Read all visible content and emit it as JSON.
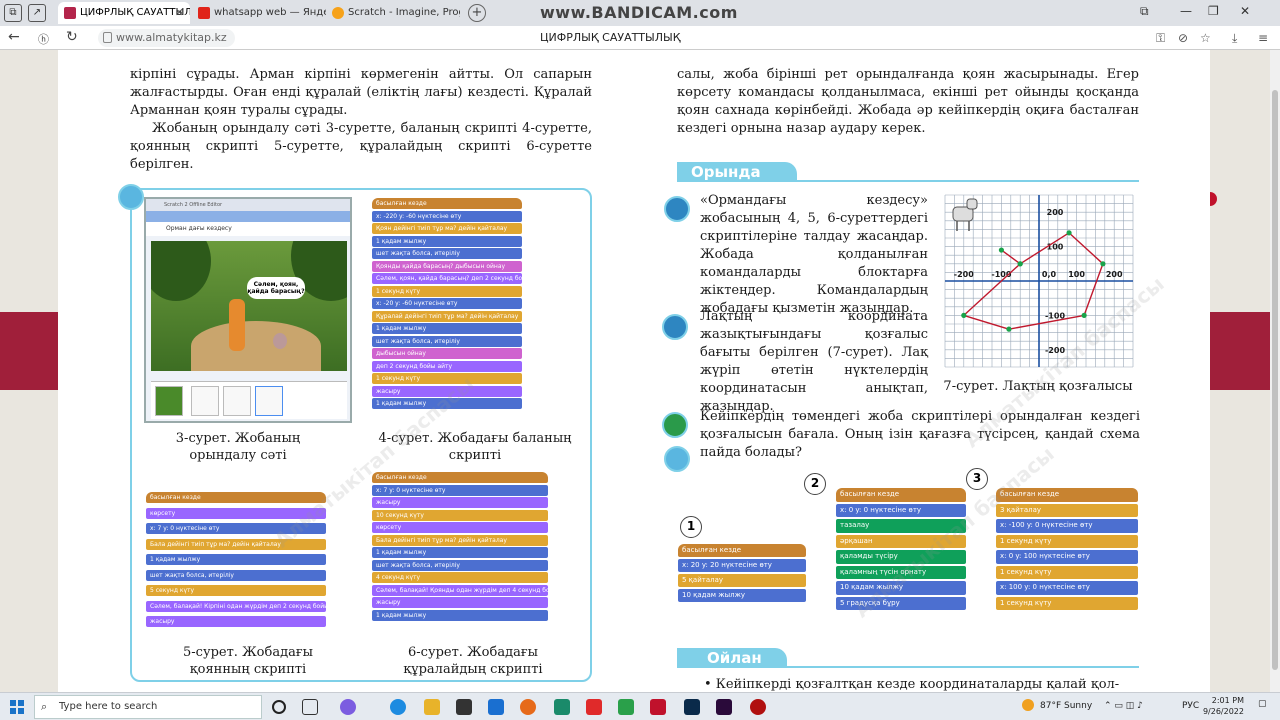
{
  "browser": {
    "tabs": [
      {
        "label": "ЦИФРЛЫҚ САУАТТЫЛЫ",
        "active": true
      },
      {
        "label": "whatsapp web — Яндекс:",
        "active": false
      },
      {
        "label": "Scratch - Imagine, Program",
        "active": false
      }
    ],
    "recorder_watermark": "www.BANDICAM.com",
    "url": "www.almatykitap.kz",
    "page_title": "ЦИФРЛЫҚ САУАТТЫЛЫҚ"
  },
  "left_page": {
    "intro": {
      "p1": "кірпіні сұрады. Арман кірпіні көрмегенін айтты. Ол сапарын жалғастырды. Оған енді құралай (еліктің лағы) кездесті. Құралай Арманнан қоян туралы сұрады.",
      "p2": "Жобаның орындалу сәті 3-суретте, баланың скрипті 4-суретте, қоянның скрипті 5-суретте, құралайдың скрипті 6-суретте берілген."
    },
    "screenshot": {
      "app_title": "Scratch 2 Offline Editor",
      "project_title": "Орман дағы кездесу",
      "speech": "Сәлем, қоян, қайда барасың?"
    },
    "captions": {
      "fig3": "3-сурет. Жобаның орындалу сәті",
      "fig4": "4-сурет. Жобадағы баланың скрипті",
      "fig5": "5-сурет. Жобадағы қоянның скрипті",
      "fig6": "6-сурет. Жобадағы құралайдың скрипті"
    },
    "fig4_blocks": [
      "басылған кезде",
      "x: -220 y: -60 нүктесіне өту",
      "Қоян дейінгі тиіп тұр ма? дейін қайталау",
      "1 қадам жылжу",
      "шет жақта болса, итеріліу",
      "Қоянды қайда барасың? дыбысын ойнау",
      "Сәлем, қоян, қайда барасың? деп 2 секунд бойы айту",
      "1 секунд күту",
      "x: -20 y: -60 нүктесіне өту",
      "Құралай дейінгі тиіп тұр ма? дейін қайталау",
      "1 қадам жылжу",
      "шет жақта болса, итеріліу",
      "дыбысын ойнау",
      "деп 2 секунд бойы айту",
      "1 секунд күту",
      "жасыру",
      "1 қадам жылжу"
    ],
    "fig5_blocks": [
      "басылған кезде",
      "көрсету",
      "x: 7 y: 0 нүктесіне өту",
      "Бала дейінгі тиіп тұр ма? дейін қайталау",
      "1 қадам жылжу",
      "шет жақта болса, итеріліу",
      "5 секунд күту",
      "Сәлем, балақай! Кірпіні одан жүрдім деп 2 секунд бойы айту",
      "жасыру"
    ],
    "fig6_blocks": [
      "басылған кезде",
      "x: 7 y: 0 нүктесіне өту",
      "жасыру",
      "10 секунд күту",
      "көрсету",
      "Бала дейінгі тиіп тұр ма? дейін қайталау",
      "1 қадам жылжу",
      "шет жақта болса, итеріліу",
      "4 секунд күту",
      "Сәлем, балақай! Қоянды одан жүрдім деп 4 секунд бойы айту",
      "жасыру",
      "1 қадам жылжу"
    ]
  },
  "right_page": {
    "intro": "салы, жоба бірінші рет орындалғанда қоян жасырынады. Егер көрсету командасы қолданылмаса, екінші рет ойынды қосқанда қоян сахнада көрінбейді. Жобада әр кейіпкердің оқиға басталған кездегі орнына назар аудару керек.",
    "section_orynda": "Орында",
    "task1": "«Ормандағы кездесу» жобасының 4, 5, 6-суреттердегі скриптілеріне талдау жасаңдар. Жобада қолданылған командаларды блоктарға жіктеңдер. Командалардың жобадағы қызметін жазыңдар.",
    "task2": "Лақтың координата жазықтығындағы қозғалыс бағыты берілген (7-сурет). Лақ жүріп өтетін нүктелердің координатасын анықтап, жазыңдар.",
    "fig7_caption": "7-сурет. Лақтың қозғалысы",
    "task3": "Кейіпкердің төмендегі жоба скриптілері орындалған кездегі қозғалысын бағала. Оның ізін қағазға түсірсең, қандай схема пайда болады?",
    "script1": {
      "number": "1",
      "blocks": [
        "басылған кезде",
        "x: 20 y: 20 нүктесіне өту",
        "5 қайталау",
        "10 қадам жылжу"
      ]
    },
    "script2": {
      "number": "2",
      "blocks": [
        "басылған кезде",
        "x: 0 y: 0 нүктесіне өту",
        "тазалау",
        "әрқашан",
        "қаламды түсіру",
        "қаламның түсін орнату",
        "10 қадам жылжу",
        "5 градусқа бұру"
      ]
    },
    "script3": {
      "number": "3",
      "blocks": [
        "басылған кезде",
        "3 қайталау",
        "x: -100 y: 0 нүктесіне өту",
        "1 секунд күту",
        "x: 0 y: 100 нүктесіне өту",
        "1 секунд күту",
        "x: 100 y: 0 нүктесіне өту",
        "1 секунд күту"
      ]
    },
    "section_oilan": "Ойлан",
    "oilan_bullet": "• Кейіпкерді қозғалтқан кезде координаталарды қалай қол-",
    "watermark": "Алматыкітап баспасы"
  },
  "chart_data": {
    "type": "scatter",
    "title": "",
    "xlabel": "",
    "ylabel": "",
    "x_ticks": [
      "-200",
      "-100",
      "0,0",
      "100",
      "200"
    ],
    "y_ticks": [
      "200",
      "100",
      "-100",
      "-200"
    ],
    "xlim": [
      -250,
      250
    ],
    "ylim": [
      -250,
      250
    ],
    "grid": true,
    "path": [
      [
        -100,
        90
      ],
      [
        -50,
        50
      ],
      [
        80,
        140
      ],
      [
        170,
        50
      ],
      [
        120,
        -100
      ],
      [
        -80,
        -140
      ],
      [
        -200,
        -100
      ],
      [
        -50,
        50
      ]
    ],
    "path_color": "#c0192e",
    "point_color": "#1aa34a"
  },
  "taskbar": {
    "search_placeholder": "Type here to search",
    "weather": "87°F  Sunny",
    "lang": "РУС",
    "time": "2:01 PM",
    "date": "9/26/2022"
  }
}
